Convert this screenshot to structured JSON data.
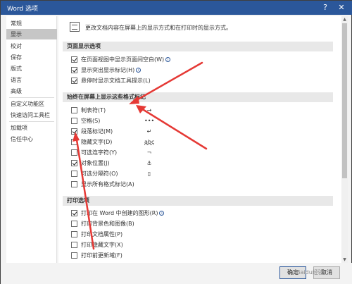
{
  "window": {
    "title": "Word 选项",
    "help_glyph": "?",
    "close_glyph": "✕"
  },
  "sidebar": {
    "items": [
      {
        "label": "常规"
      },
      {
        "label": "显示",
        "active": true
      },
      {
        "label": "校对"
      },
      {
        "label": "保存"
      },
      {
        "label": "版式"
      },
      {
        "label": "语言"
      },
      {
        "label": "高级"
      },
      {
        "label": "自定义功能区"
      },
      {
        "label": "快速访问工具栏"
      },
      {
        "label": "加载项"
      },
      {
        "label": "信任中心"
      }
    ]
  },
  "main": {
    "intro": "更改文档内容在屏幕上的显示方式和在打印时的显示方式。",
    "page_display": {
      "header": "页面显示选项",
      "options": [
        {
          "label": "在页面视图中显示页面间空白(W)",
          "checked": true,
          "info": true
        },
        {
          "label": "显示突出显示标记(H)",
          "checked": true,
          "info": true
        },
        {
          "label": "悬停时显示文档工具提示(L)",
          "checked": true,
          "info": false
        }
      ]
    },
    "format_marks": {
      "header": "始终在屏幕上显示这些格式标记",
      "options": [
        {
          "label": "制表符(T)",
          "checked": false,
          "glyph": "→"
        },
        {
          "label": "空格(S)",
          "checked": false,
          "glyph": "•••"
        },
        {
          "label": "段落标记(M)",
          "checked": true,
          "glyph": "↵"
        },
        {
          "label": "隐藏文字(D)",
          "checked": false,
          "glyph": "abc"
        },
        {
          "label": "可选连字符(Y)",
          "checked": false,
          "glyph": "¬"
        },
        {
          "label": "对象位置(J)",
          "checked": true,
          "glyph": "⚓"
        },
        {
          "label": "可选分隔符(O)",
          "checked": false,
          "glyph": "▯"
        },
        {
          "label": "显示所有格式标记(A)",
          "checked": false,
          "glyph": ""
        }
      ]
    },
    "print": {
      "header": "打印选项",
      "options": [
        {
          "label": "打印在 Word 中创建的图形(R)",
          "checked": true,
          "info": true
        },
        {
          "label": "打印背景色和图像(B)",
          "checked": false,
          "info": false
        },
        {
          "label": "打印文档属性(P)",
          "checked": false,
          "info": false
        },
        {
          "label": "打印隐藏文字(X)",
          "checked": false,
          "info": false
        },
        {
          "label": "打印前更新域(F)",
          "checked": false,
          "info": false
        }
      ]
    }
  },
  "footer": {
    "ok_label": "确定",
    "cancel_label": "取消"
  },
  "watermark": "Baidu经验",
  "colors": {
    "titlebar": "#2b579a",
    "arrow": "#e53935",
    "active_sidebar": "#c6c6c6"
  }
}
